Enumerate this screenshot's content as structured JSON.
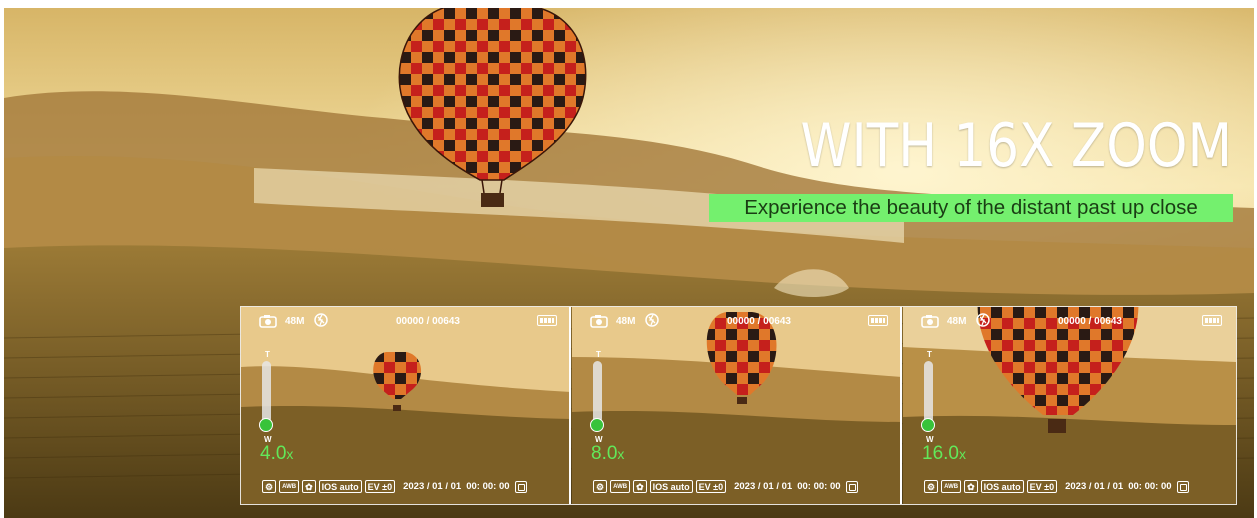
{
  "headline": "WITH 16X ZOOM",
  "subheadline": "Experience the beauty of the distant past up close",
  "colors": {
    "accent_green": "#74f06e",
    "zoom_text_green": "#62e85a",
    "knob_green": "#38c33a"
  },
  "panels": [
    {
      "resolution": "48M",
      "counter": "00000 / 00643",
      "zoom_tele_label": "T",
      "zoom_wide_label": "W",
      "zoom_value": "4.0",
      "zoom_unit": "x",
      "awb": "AWB",
      "iso": "IOS auto",
      "ev": "EV ±0",
      "date": "2023 / 01 / 01",
      "time": "00: 00: 00"
    },
    {
      "resolution": "48M",
      "counter": "00000 / 00643",
      "zoom_tele_label": "T",
      "zoom_wide_label": "W",
      "zoom_value": "8.0",
      "zoom_unit": "x",
      "awb": "AWB",
      "iso": "IOS auto",
      "ev": "EV ±0",
      "date": "2023 / 01 / 01",
      "time": "00: 00: 00"
    },
    {
      "resolution": "48M",
      "counter": "00000 / 00643",
      "zoom_tele_label": "T",
      "zoom_wide_label": "W",
      "zoom_value": "16.0",
      "zoom_unit": "x",
      "awb": "AWB",
      "iso": "IOS auto",
      "ev": "EV ±0",
      "date": "2023 / 01 / 01",
      "time": "00: 00: 00"
    }
  ],
  "icons": {
    "camera": "camera-mode-icon",
    "flash": "flash-off-icon",
    "battery": "battery-full-icon",
    "settings": "gear-icon",
    "stabilize": "stabilizer-icon",
    "playback": "playback-icon"
  }
}
